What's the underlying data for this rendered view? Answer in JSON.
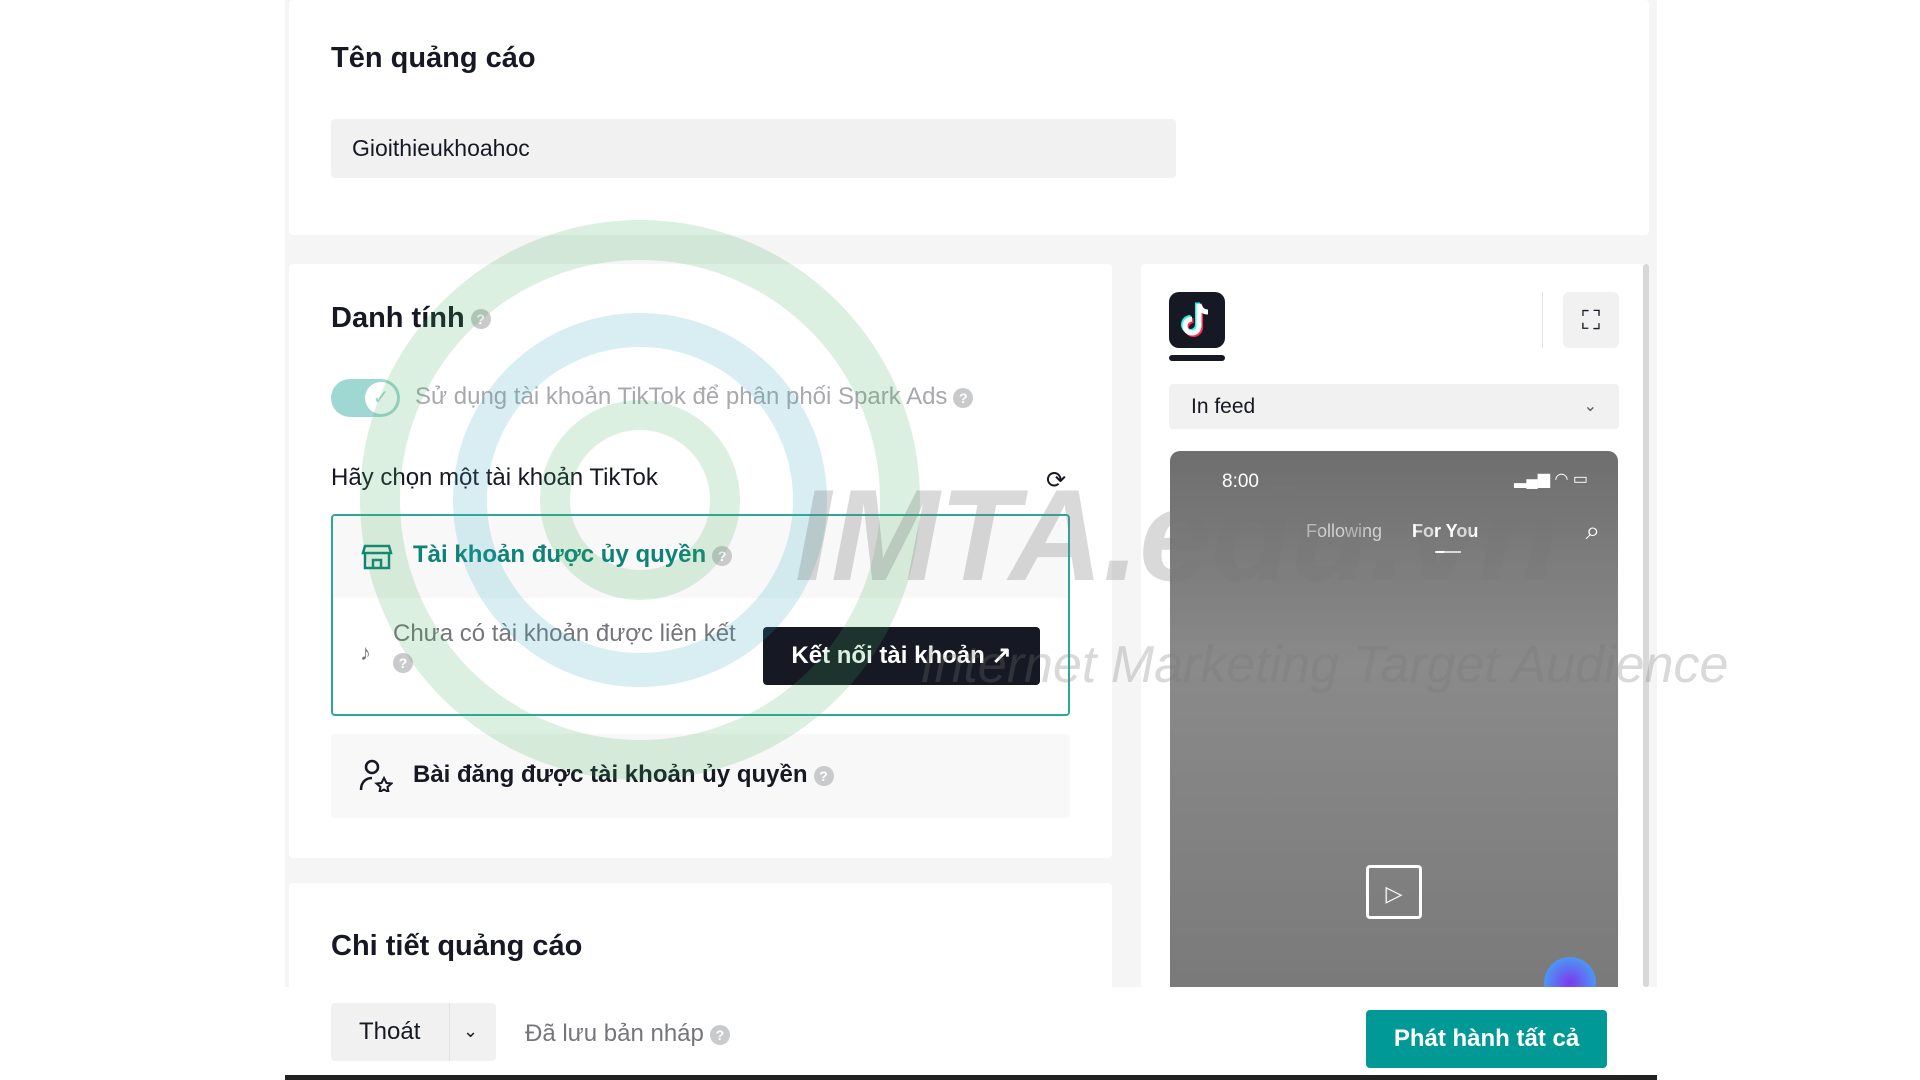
{
  "ad_name": {
    "title": "Tên quảng cáo",
    "value": "Gioithieukhoahoc"
  },
  "identity": {
    "title": "Danh tính",
    "spark_toggle": {
      "label": "Sử dụng tài khoản TikTok để phân phối Spark Ads",
      "on": true
    },
    "choose_label": "Hãy chọn một tài khoản TikTok",
    "authorized_account": {
      "label": "Tài khoản được ủy quyền",
      "empty_text": "Chưa có tài khoản được liên kết",
      "connect_label": "Kết nối tài khoản"
    },
    "authorized_posts": {
      "label": "Bài đăng được tài khoản ủy quyền"
    }
  },
  "ad_details": {
    "title": "Chi tiết quảng cáo"
  },
  "preview": {
    "placement": "In feed",
    "phone": {
      "time": "8:00",
      "tab_following": "Following",
      "tab_for_you": "For You"
    }
  },
  "footer": {
    "exit_label": "Thoát",
    "saved_status": "Đã lưu bản nháp",
    "publish_label": "Phát hành tất cả"
  },
  "watermark": {
    "brand": "IMTA.edu.vn",
    "tagline": "Internet Marketing Target Audience"
  },
  "colors": {
    "accent": "#009995",
    "accent_text": "#0d8377",
    "dark_button": "#161823"
  }
}
